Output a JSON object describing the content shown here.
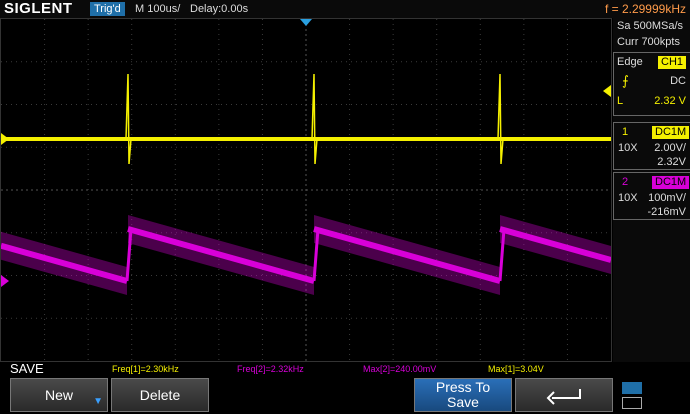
{
  "header": {
    "brand": "SIGLENT",
    "trigger_state": "Trig'd",
    "timebase": "M 100us/",
    "delay": "Delay:0.00s",
    "frequency": "f = 2.29999kHz"
  },
  "acquisition": {
    "sample_rate": "Sa 500MSa/s",
    "memory": "Curr 700kpts"
  },
  "trigger": {
    "type": "Edge",
    "source": "CH1",
    "coupling": "DC",
    "level_label": "L",
    "level_value": "2.32 V"
  },
  "channel1": {
    "number": "1",
    "coupling_tag": "DC1M",
    "probe": "10X",
    "scale": "2.00V/",
    "offset": "2.32V",
    "color": "#f5f000"
  },
  "channel2": {
    "number": "2",
    "coupling_tag": "DC1M",
    "probe": "10X",
    "scale": "100mV/",
    "offset": "-216mV",
    "color": "#d800d8"
  },
  "measurements": [
    {
      "label": "Freq[1]=2.30kHz",
      "color": "#f5f000"
    },
    {
      "label": "Freq[2]=2.32kHz",
      "color": "#d800d8"
    },
    {
      "label": "Max[2]=240.00mV",
      "color": "#d800d8"
    },
    {
      "label": "Max[1]=3.04V",
      "color": "#f5f000"
    }
  ],
  "menu": {
    "title": "SAVE",
    "softkeys": [
      "New",
      "Delete",
      "Press To Save"
    ]
  },
  "icons": [
    "trigger-rising-edge-icon",
    "return-arrow-icon",
    "usb-icon",
    "network-icon"
  ]
}
